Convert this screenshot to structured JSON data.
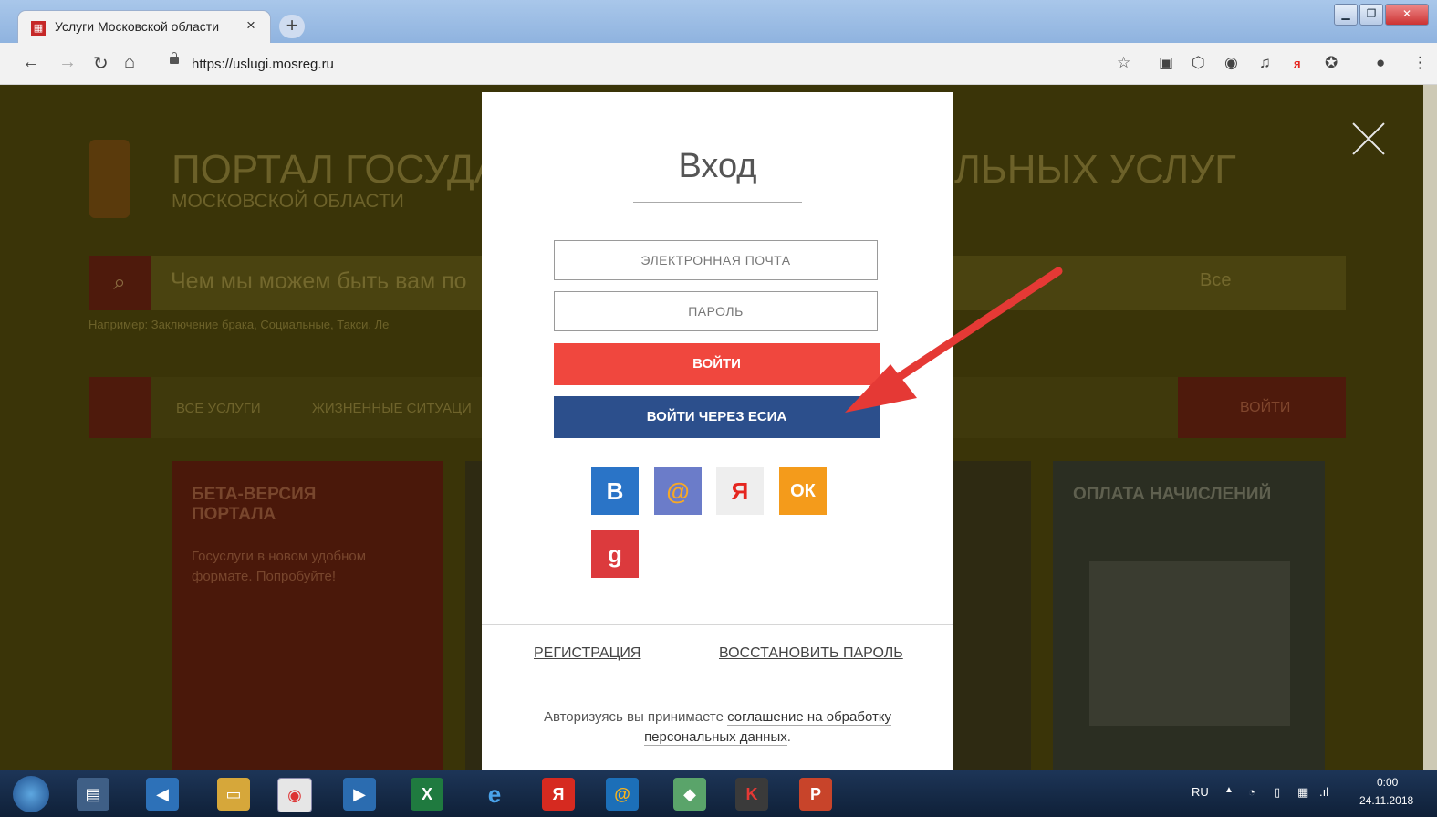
{
  "browser": {
    "tab_title": "Услуги Московской области",
    "tab_close": "×",
    "new_tab": "+",
    "url": "https://uslugi.mosreg.ru"
  },
  "background": {
    "portal_title": "ПОРТАЛ ГОСУДАР",
    "portal_title_right": "ЛЬНЫХ УСЛУГ",
    "portal_subtitle": "МОСКОВСКОЙ ОБЛАСТИ",
    "search_placeholder": "Чем мы можем быть вам по",
    "search_scope": "Все",
    "examples": "Например: Заключение брака, Социальные, Такси, Ле",
    "nav_all": "ВСЕ УСЛУГИ",
    "nav_life": "ЖИЗНЕННЫЕ СИТУАЦИ",
    "nav_login": "ВОЙТИ",
    "card_beta_title": "БЕТА-ВЕРСИЯ ПОРТАЛА",
    "card_beta_text": "Госуслуги в новом удобном формате. Попробуйте!",
    "card_pay_title": "ОПЛАТА НАЧИСЛЕНИЙ"
  },
  "modal": {
    "title": "Вход",
    "email_placeholder": "ЭЛЕКТРОННАЯ ПОЧТА",
    "password_placeholder": "ПАРОЛЬ",
    "login_button": "ВОЙТИ",
    "esia_button": "ВОЙТИ ЧЕРЕЗ ЕСИА",
    "social": [
      {
        "label": "В",
        "bg": "#2a74c7",
        "color": "#ffffff",
        "icon": "vk-icon"
      },
      {
        "label": "@",
        "bg": "#6b7cc9",
        "color": "#f7a825",
        "icon": "mailru-icon"
      },
      {
        "label": "Я",
        "bg": "#eeeeee",
        "color": "#e52620",
        "icon": "yandex-icon"
      },
      {
        "label": "ОК",
        "bg": "#f49b1b",
        "color": "#ffffff",
        "icon": "odnoklassniki-icon"
      },
      {
        "label": "g",
        "bg": "#dc3a3d",
        "color": "#ffffff",
        "icon": "google-icon"
      }
    ],
    "register_link": "РЕГИСТРАЦИЯ",
    "restore_link": "ВОССТАНОВИТЬ ПАРОЛЬ",
    "note_prefix": "Авторизуясь вы принимаете",
    "note_link": "соглашение на обработку персональных данных",
    "note_suffix": "."
  },
  "taskbar": {
    "lang": "RU",
    "time": "0:00",
    "date": "24.11.2018"
  },
  "colors": {
    "login_red": "#f0473e",
    "esia_blue": "#2c4f8c",
    "arrow_red": "#e53935"
  }
}
